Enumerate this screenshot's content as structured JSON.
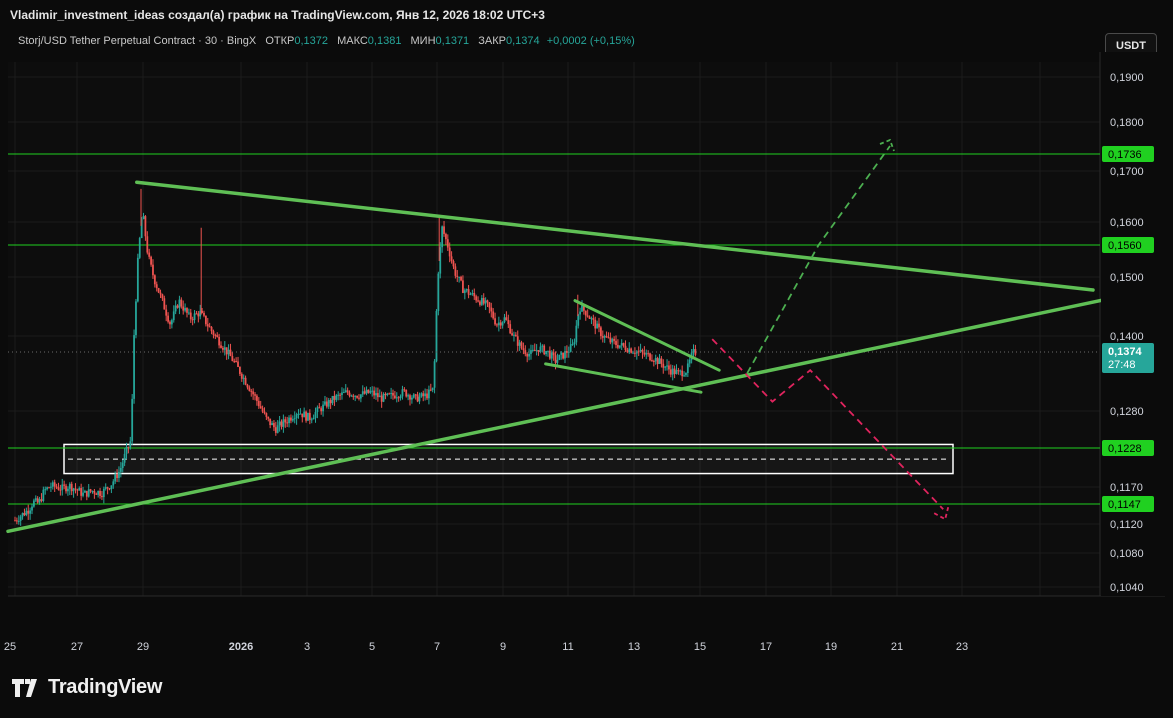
{
  "header": {
    "caption": "Vladimir_investment_ideas создал(а) график на TradingView.com, Янв 12, 2026 18:02 UTC+3"
  },
  "legend": {
    "symbol": "Storj/USD Tether Perpetual Contract · 30 · BingX",
    "open_label": "ОТКР",
    "open_value": "0,1372",
    "high_label": "МАКС",
    "high_value": "0,1381",
    "low_label": "МИН",
    "low_value": "0,1371",
    "close_label": "ЗАКР",
    "close_value": "0,1374",
    "change": "+0,0002 (+0,15%)"
  },
  "currency_button": "USDT",
  "brand": {
    "name": "TradingView"
  },
  "colors": {
    "background": "#0b0b0b",
    "up": "#26a69a",
    "down": "#ef5350",
    "trendline": "#5fbf55",
    "level": "#20d020",
    "projection_up": "#4caf50",
    "projection_down": "#e0245e",
    "zone": "#ffffff"
  },
  "chart_data": {
    "type": "candlestick",
    "title": "Storj/USD Tether Perpetual Contract · 30 · BingX",
    "ylabel": "USDT",
    "x_ticks": [
      "25",
      "27",
      "29",
      "2026",
      "3",
      "5",
      "7",
      "9",
      "11",
      "13",
      "15",
      "17",
      "19",
      "21",
      "23"
    ],
    "y_ticks": [
      "0,1900",
      "0,1800",
      "0,1700",
      "0,1600",
      "0,1500",
      "0,1400",
      "0,1280",
      "0,1170",
      "0,1120",
      "0,1080",
      "0,1040"
    ],
    "y_tick_values": [
      0.19,
      0.18,
      0.17,
      0.16,
      0.15,
      0.14,
      0.128,
      0.117,
      0.112,
      0.108,
      0.104
    ],
    "last_price": {
      "value": 0.1374,
      "label": "0,1374",
      "countdown": "27:48"
    },
    "horizontal_levels": [
      {
        "value": 0.1736,
        "label": "0,1736"
      },
      {
        "value": 0.156,
        "label": "0,1560"
      },
      {
        "value": 0.1228,
        "label": "0,1228"
      },
      {
        "value": 0.1147,
        "label": "0,1147"
      }
    ],
    "price_path": [
      [
        0.0,
        0.1125
      ],
      [
        1.0,
        0.114
      ],
      [
        1.3,
        0.115
      ],
      [
        1.7,
        0.1148
      ],
      [
        2.1,
        0.1165
      ],
      [
        2.6,
        0.1172
      ],
      [
        3.4,
        0.1168
      ],
      [
        3.9,
        0.1172
      ],
      [
        4.5,
        0.1165
      ],
      [
        4.9,
        0.116
      ],
      [
        5.5,
        0.1165
      ],
      [
        6.2,
        0.1162
      ],
      [
        6.9,
        0.1175
      ],
      [
        7.5,
        0.1195
      ],
      [
        7.9,
        0.122
      ],
      [
        8.3,
        0.124
      ],
      [
        8.5,
        0.14
      ],
      [
        8.8,
        0.154
      ],
      [
        9.1,
        0.162
      ],
      [
        9.5,
        0.154
      ],
      [
        9.9,
        0.15
      ],
      [
        10.5,
        0.146
      ],
      [
        11.1,
        0.142
      ],
      [
        11.7,
        0.146
      ],
      [
        12.5,
        0.143
      ],
      [
        13.2,
        0.144
      ],
      [
        14.0,
        0.141
      ],
      [
        14.8,
        0.1385
      ],
      [
        15.6,
        0.136
      ],
      [
        16.4,
        0.133
      ],
      [
        17.2,
        0.13
      ],
      [
        17.9,
        0.127
      ],
      [
        18.6,
        0.1255
      ],
      [
        19.3,
        0.1265
      ],
      [
        20.2,
        0.128
      ],
      [
        21.0,
        0.127
      ],
      [
        21.9,
        0.1285
      ],
      [
        22.8,
        0.13
      ],
      [
        23.7,
        0.131
      ],
      [
        24.5,
        0.1305
      ],
      [
        25.4,
        0.131
      ],
      [
        26.2,
        0.13
      ],
      [
        27.0,
        0.1305
      ],
      [
        27.8,
        0.131
      ],
      [
        28.6,
        0.13
      ],
      [
        29.4,
        0.1305
      ],
      [
        29.9,
        0.1315
      ],
      [
        30.2,
        0.15
      ],
      [
        30.5,
        0.159
      ],
      [
        30.9,
        0.156
      ],
      [
        31.4,
        0.151
      ],
      [
        32.0,
        0.148
      ],
      [
        32.6,
        0.147
      ],
      [
        33.2,
        0.146
      ],
      [
        33.8,
        0.145
      ],
      [
        34.4,
        0.142
      ],
      [
        35.0,
        0.143
      ],
      [
        35.6,
        0.14
      ],
      [
        36.2,
        0.138
      ],
      [
        36.8,
        0.137
      ],
      [
        37.4,
        0.138
      ],
      [
        38.0,
        0.1375
      ],
      [
        38.6,
        0.136
      ],
      [
        39.2,
        0.137
      ],
      [
        39.9,
        0.1385
      ],
      [
        40.3,
        0.145
      ],
      [
        40.8,
        0.144
      ],
      [
        41.4,
        0.142
      ],
      [
        42.0,
        0.14
      ],
      [
        42.6,
        0.139
      ],
      [
        43.2,
        0.1385
      ],
      [
        43.8,
        0.138
      ],
      [
        44.4,
        0.1375
      ],
      [
        45.0,
        0.137
      ],
      [
        45.6,
        0.1365
      ],
      [
        46.2,
        0.1355
      ],
      [
        46.8,
        0.1345
      ],
      [
        47.4,
        0.134
      ],
      [
        48.0,
        0.1345
      ],
      [
        48.4,
        0.1372
      ],
      [
        48.6,
        0.1374
      ]
    ],
    "time_domain": [
      -0.5,
      77.5
    ],
    "price_domain": [
      0.1005,
      0.1955
    ],
    "drawings": {
      "triangle_upper": [
        [
          8.7,
          0.1678
        ],
        [
          77.0,
          0.1478
        ]
      ],
      "triangle_lower": [
        [
          -0.5,
          0.111
        ],
        [
          78.5,
          0.1465
        ]
      ],
      "flag_upper": [
        [
          40.0,
          0.146
        ],
        [
          50.3,
          0.1345
        ]
      ],
      "flag_lower": [
        [
          37.9,
          0.1355
        ],
        [
          49.0,
          0.131
        ]
      ],
      "projection_up": [
        [
          52.3,
          0.134
        ],
        [
          57.4,
          0.156
        ],
        [
          62.5,
          0.1752
        ]
      ],
      "projection_down": [
        [
          49.8,
          0.1395
        ],
        [
          54.1,
          0.1295
        ],
        [
          56.8,
          0.1345
        ],
        [
          66.3,
          0.114
        ]
      ],
      "support_zone": {
        "top": 0.1233,
        "bottom": 0.119,
        "from": 3.5,
        "to": 67.0
      }
    }
  }
}
